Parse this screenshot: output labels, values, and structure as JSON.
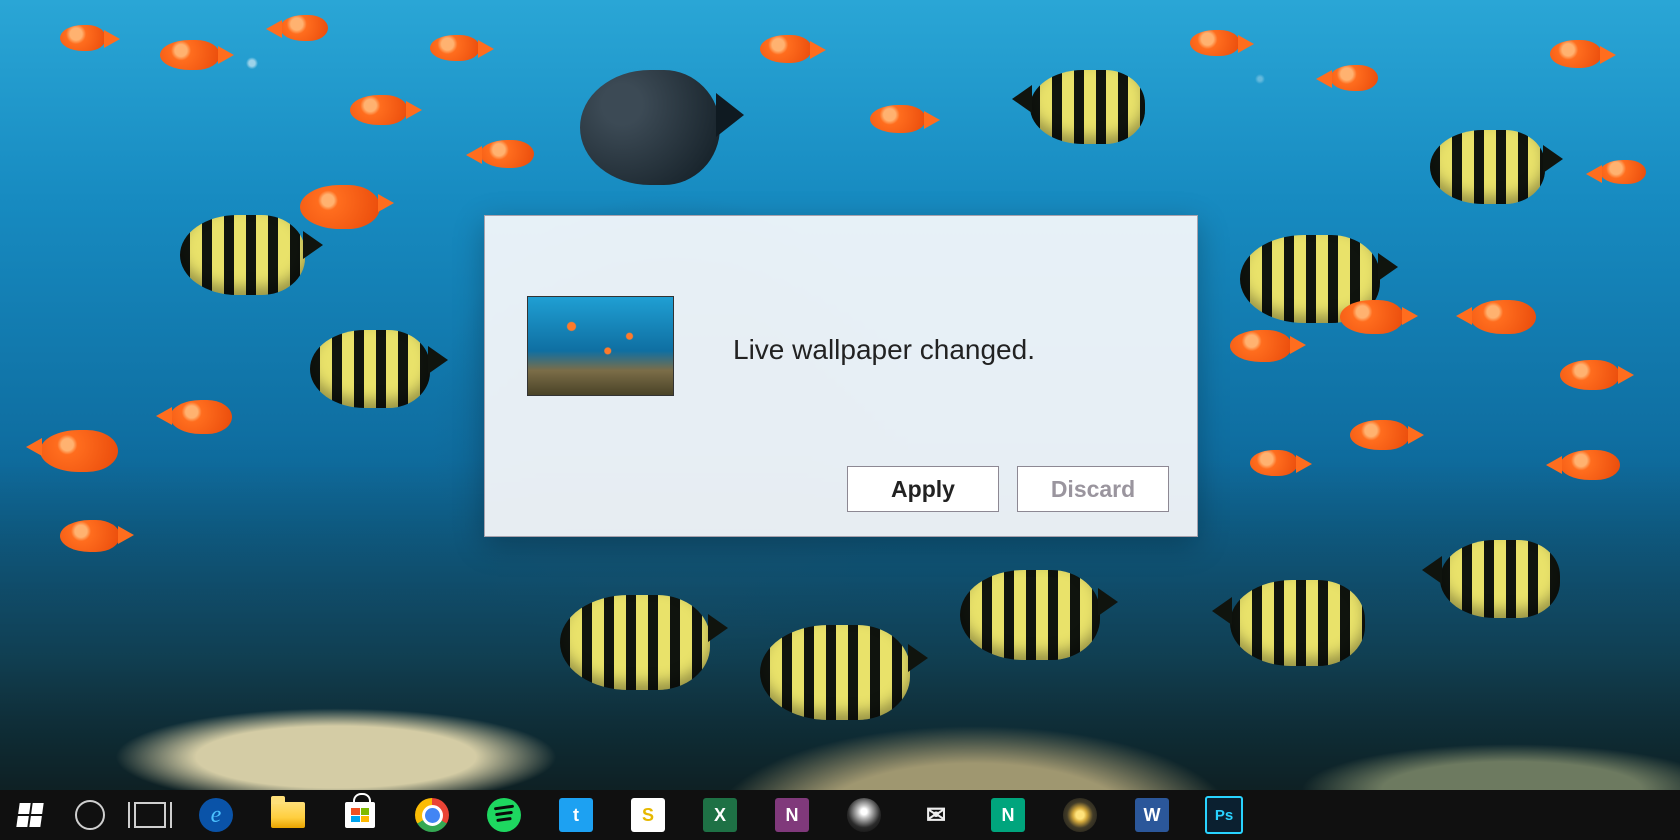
{
  "dialog": {
    "message": "Live wallpaper changed.",
    "apply_label": "Apply",
    "discard_label": "Discard"
  },
  "taskbar": {
    "items": [
      {
        "name": "start-button",
        "letter": ""
      },
      {
        "name": "cortana-button",
        "letter": ""
      },
      {
        "name": "task-view-button",
        "letter": ""
      },
      {
        "name": "edge-browser",
        "bg": "#0a53a8",
        "letter": "e",
        "circle": true,
        "fg": "#4cc2ff"
      },
      {
        "name": "file-explorer",
        "bg": "#ffcf3f",
        "letter": "",
        "folder": true
      },
      {
        "name": "windows-store",
        "bg": "#0a0a0a",
        "letter": "",
        "bag": true
      },
      {
        "name": "google-chrome",
        "bg": "#ffffff",
        "letter": "",
        "chrome": true
      },
      {
        "name": "spotify",
        "bg": "#1ed760",
        "letter": "",
        "circle": true,
        "spot": true
      },
      {
        "name": "twitter",
        "bg": "#1da1f2",
        "letter": "t"
      },
      {
        "name": "slack",
        "bg": "#ffffff",
        "letter": "S",
        "fg": "#e6b800"
      },
      {
        "name": "excel",
        "bg": "#1e7145",
        "letter": "X"
      },
      {
        "name": "onenote",
        "bg": "#80397b",
        "letter": "N"
      },
      {
        "name": "xbox",
        "bg": "#0a0a0a",
        "letter": "",
        "xbox": true
      },
      {
        "name": "mail",
        "bg": "#0a0a0a",
        "letter": "✉",
        "fg": "#eee"
      },
      {
        "name": "app-n",
        "bg": "#00a57d",
        "letter": "N"
      },
      {
        "name": "sonos",
        "bg": "#1a1a1a",
        "letter": "",
        "sonos": true
      },
      {
        "name": "word",
        "bg": "#2b579a",
        "letter": "W"
      },
      {
        "name": "photoshop",
        "bg": "#0b2030",
        "letter": "Ps",
        "fg": "#29d3ff",
        "border": "#29d3ff"
      }
    ]
  }
}
